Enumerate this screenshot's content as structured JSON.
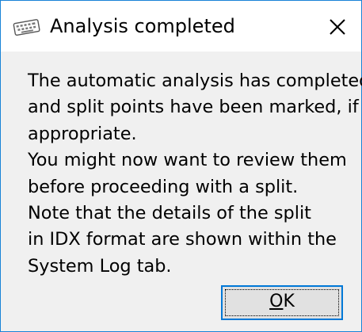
{
  "window": {
    "title": "Analysis completed",
    "icon": "keyboard-icon",
    "close_icon": "close-icon"
  },
  "message": {
    "lines": [
      "The automatic analysis has completed",
      "and split points have been marked, if",
      "appropriate.",
      "You might now want to review them",
      "before proceeding with a split.",
      "Note that the details of the split",
      "in IDX format are shown within the",
      "System Log tab."
    ]
  },
  "buttons": {
    "ok": {
      "mnemonic": "O",
      "rest": "K"
    }
  },
  "colors": {
    "window_border": "#1883d7",
    "title_background": "#ffffff",
    "body_background": "#f0f0f0",
    "button_face": "#e1e1e1",
    "button_focus_border": "#0078d7"
  }
}
